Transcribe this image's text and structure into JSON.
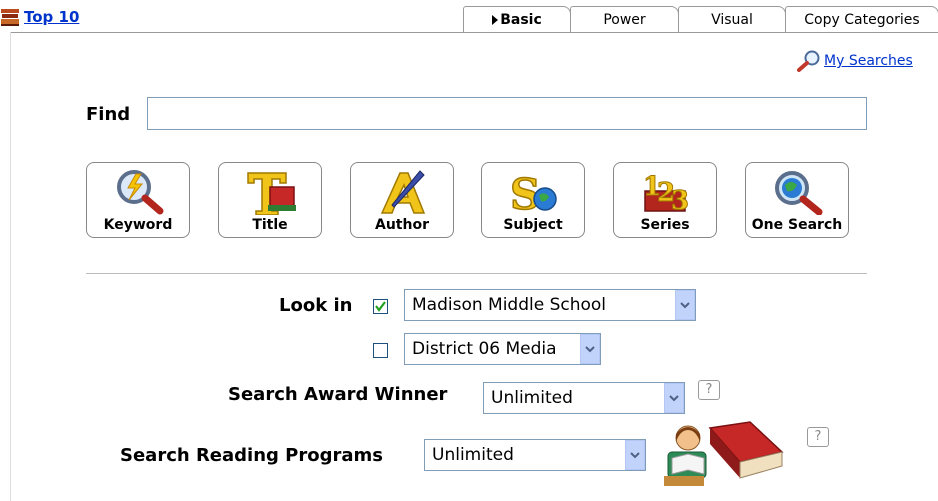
{
  "header": {
    "top10_label": "Top 10"
  },
  "tabs": [
    {
      "label": "Basic",
      "active": true
    },
    {
      "label": "Power",
      "active": false
    },
    {
      "label": "Visual",
      "active": false
    },
    {
      "label": "Copy Categories",
      "active": false
    }
  ],
  "my_searches_label": "My Searches",
  "find": {
    "label": "Find",
    "value": "",
    "placeholder": ""
  },
  "search_buttons": [
    {
      "label": "Keyword",
      "icon": "keyword-magnifier-icon"
    },
    {
      "label": "Title",
      "icon": "title-book-icon"
    },
    {
      "label": "Author",
      "icon": "author-quill-icon"
    },
    {
      "label": "Subject",
      "icon": "subject-icon"
    },
    {
      "label": "Series",
      "icon": "series-123-icon"
    },
    {
      "label": "One Search",
      "icon": "globe-magnifier-icon"
    }
  ],
  "look_in": {
    "label": "Look in",
    "options": [
      {
        "value": "Madison Middle School",
        "checked": true
      },
      {
        "value": "District 06 Media",
        "checked": false
      }
    ]
  },
  "award": {
    "label": "Search Award Winner",
    "value": "Unlimited",
    "help": "?"
  },
  "reading": {
    "label": "Search Reading Programs",
    "value": "Unlimited",
    "help": "?"
  },
  "colors": {
    "link": "#0033cc",
    "select_border": "#7f9db9",
    "dropdown_button": "#c1d3fb",
    "check": "#21a121"
  }
}
